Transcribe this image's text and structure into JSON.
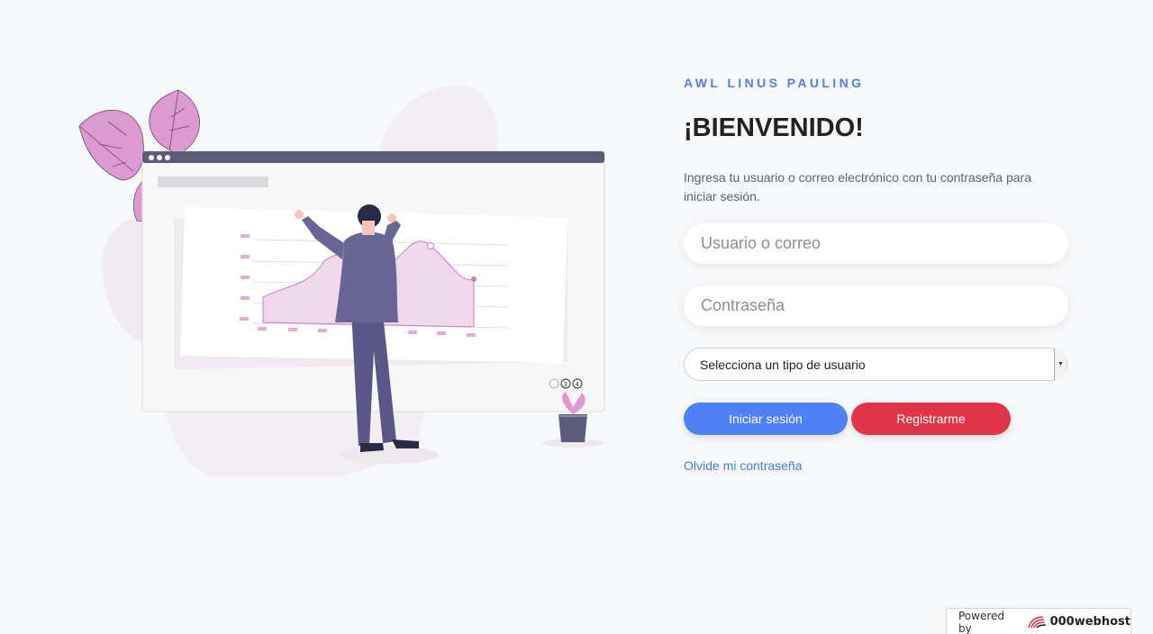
{
  "brand": {
    "name": "AWL LINUS PAULING"
  },
  "form": {
    "title": "¡BIENVENIDO!",
    "intro": "Ingresa tu usuario o correo electrónico con tu contraseña para iniciar sesión.",
    "user_placeholder": "Usuario o correo",
    "password_placeholder": "Contraseña",
    "user_type_selected": "Selecciona un tipo de usuario",
    "login_label": "Iniciar sesión",
    "register_label": "Registrarme",
    "forgot_label": "Olvide mi contraseña"
  },
  "illustration": {
    "icon": "man-presenting-chart-illustration",
    "slider_numbers": [
      "3",
      "4"
    ]
  },
  "footer": {
    "powered_label": "Powered by",
    "host_name": "000webhost",
    "host_icon": "000webhost-logo-icon"
  },
  "colors": {
    "accent": "#4e7ef5",
    "register": "#e03448",
    "illustration_pink": "#d38fc9",
    "illustration_purple": "#5e5b7a"
  }
}
